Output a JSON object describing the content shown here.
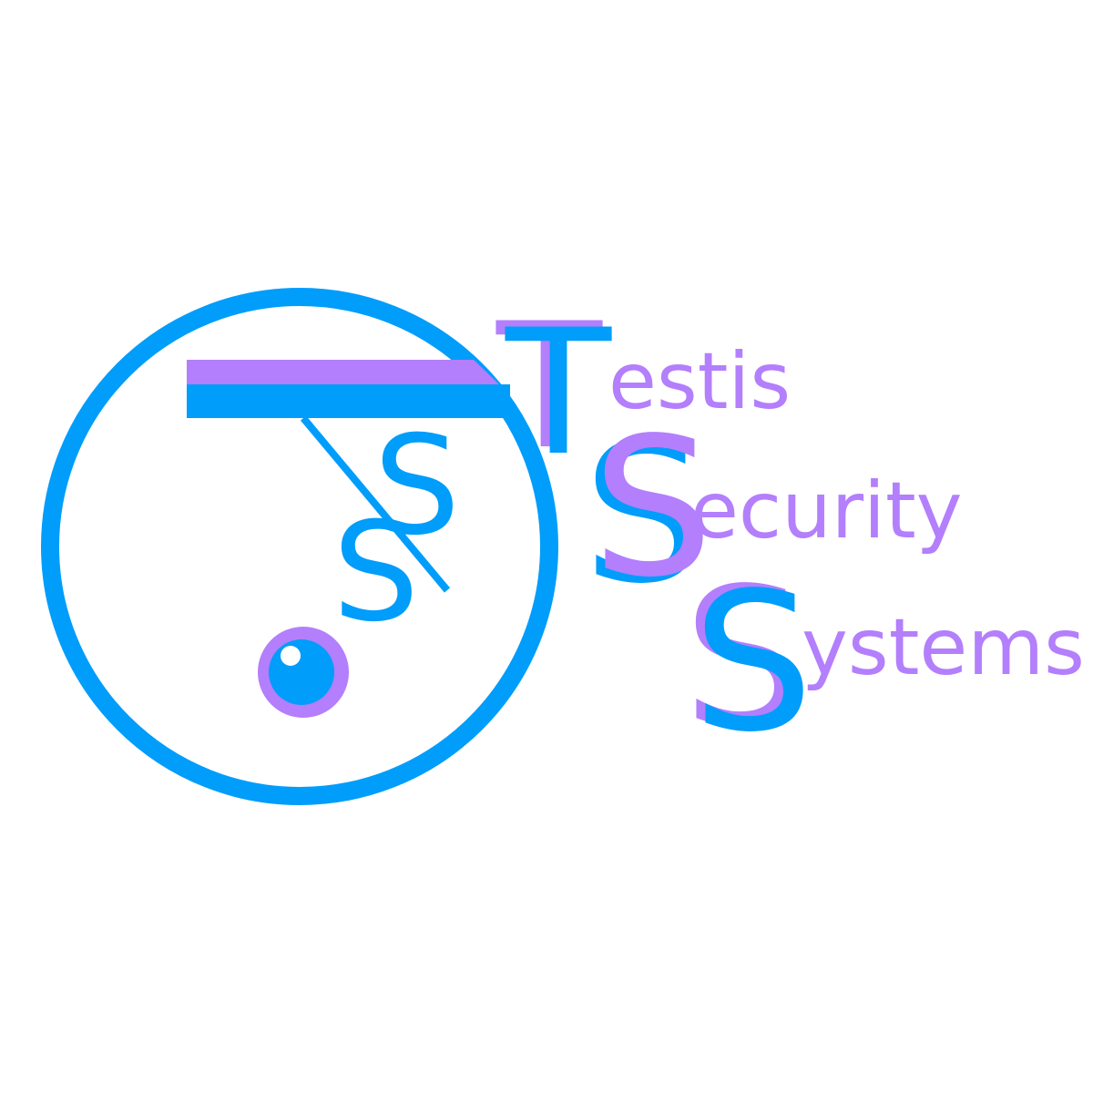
{
  "brand": {
    "line1": {
      "initial": "T",
      "rest": "estis"
    },
    "line2": {
      "initial": "S",
      "rest": "ecurity"
    },
    "line3": {
      "initial": "S",
      "rest": "ystems"
    }
  },
  "emblem": {
    "small_s_1": "S",
    "small_s_2": "S"
  },
  "colors": {
    "blue": "#009DFB",
    "purple": "#B37FFC",
    "background": "#FFFFFF"
  },
  "icons": {
    "emblem": "camera-lens-circle-icon"
  }
}
